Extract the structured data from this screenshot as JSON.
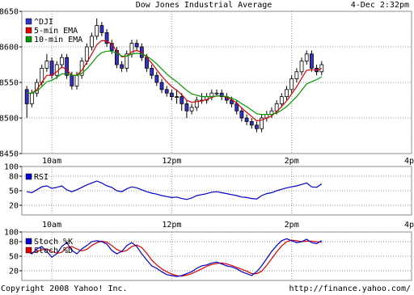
{
  "header": {
    "title": "Dow Jones Industrial Average",
    "datetime": "4-Dec 2:32pm"
  },
  "footer": {
    "copyright": "Copyright 2008 Yahoo! Inc.",
    "url": "http://finance.yahoo.com/"
  },
  "colors": {
    "candle_up": "#ffffff",
    "candle_down": "#3333cc",
    "ema5": "#dd0000",
    "ema10": "#009900",
    "rsi": "#0000cc",
    "stoch_k": "#0000cc",
    "stoch_d": "#dd0000",
    "grid": "#999999"
  },
  "chart_data": [
    {
      "type": "candlestick",
      "title": "Dow Jones Industrial Average",
      "x_ticks": [
        "10am",
        "12pm",
        "2pm",
        "4pm"
      ],
      "y_ticks": [
        8450,
        8500,
        8550,
        8600,
        8650
      ],
      "ylim": [
        8450,
        8650
      ],
      "x_range": [
        "9:30",
        "4:00"
      ],
      "grid": true,
      "legend": {
        "position": "top-left",
        "entries": [
          "^DJI",
          "5-min EMA",
          "10-min EMA"
        ]
      },
      "series": [
        {
          "name": "^DJI",
          "times": [
            "09:35",
            "09:40",
            "09:45",
            "09:50",
            "09:55",
            "10:00",
            "10:05",
            "10:10",
            "10:15",
            "10:20",
            "10:25",
            "10:30",
            "10:35",
            "10:40",
            "10:45",
            "10:50",
            "10:55",
            "11:00",
            "11:05",
            "11:10",
            "11:15",
            "11:20",
            "11:25",
            "11:30",
            "11:35",
            "11:40",
            "11:45",
            "11:50",
            "11:55",
            "12:00",
            "12:05",
            "12:10",
            "12:15",
            "12:20",
            "12:25",
            "12:30",
            "12:35",
            "12:40",
            "12:45",
            "12:50",
            "12:55",
            "13:00",
            "13:05",
            "13:10",
            "13:15",
            "13:20",
            "13:25",
            "13:30",
            "13:35",
            "13:40",
            "13:45",
            "13:50",
            "13:55",
            "14:00",
            "14:05",
            "14:10",
            "14:15",
            "14:20",
            "14:25",
            "14:30"
          ],
          "open": [
            8540,
            8520,
            8535,
            8550,
            8570,
            8580,
            8560,
            8575,
            8585,
            8560,
            8545,
            8560,
            8580,
            8600,
            8615,
            8630,
            8620,
            8605,
            8595,
            8575,
            8570,
            8590,
            8605,
            8600,
            8585,
            8570,
            8560,
            8550,
            8540,
            8535,
            8530,
            8530,
            8520,
            8510,
            8515,
            8525,
            8525,
            8530,
            8535,
            8535,
            8530,
            8525,
            8520,
            8510,
            8500,
            8495,
            8490,
            8485,
            8500,
            8505,
            8510,
            8520,
            8530,
            8540,
            8555,
            8565,
            8580,
            8590,
            8570,
            8565
          ],
          "close": [
            8520,
            8535,
            8550,
            8570,
            8580,
            8560,
            8575,
            8585,
            8560,
            8545,
            8560,
            8580,
            8600,
            8615,
            8630,
            8620,
            8605,
            8595,
            8575,
            8570,
            8590,
            8605,
            8600,
            8585,
            8570,
            8560,
            8550,
            8540,
            8535,
            8530,
            8530,
            8520,
            8510,
            8515,
            8525,
            8525,
            8530,
            8535,
            8535,
            8530,
            8525,
            8520,
            8510,
            8500,
            8495,
            8490,
            8485,
            8500,
            8505,
            8510,
            8520,
            8530,
            8540,
            8555,
            8565,
            8580,
            8590,
            8570,
            8565,
            8575
          ],
          "high": [
            8545,
            8540,
            8555,
            8575,
            8590,
            8585,
            8580,
            8590,
            8590,
            8565,
            8565,
            8585,
            8605,
            8620,
            8640,
            8635,
            8625,
            8610,
            8600,
            8580,
            8595,
            8610,
            8610,
            8605,
            8590,
            8575,
            8565,
            8555,
            8545,
            8540,
            8540,
            8535,
            8525,
            8520,
            8530,
            8535,
            8535,
            8540,
            8540,
            8540,
            8535,
            8530,
            8525,
            8515,
            8505,
            8500,
            8495,
            8505,
            8510,
            8515,
            8525,
            8535,
            8545,
            8560,
            8570,
            8585,
            8595,
            8595,
            8575,
            8580
          ],
          "low": [
            8500,
            8515,
            8530,
            8545,
            8565,
            8555,
            8555,
            8570,
            8555,
            8540,
            8540,
            8555,
            8575,
            8595,
            8610,
            8615,
            8600,
            8590,
            8570,
            8565,
            8565,
            8585,
            8595,
            8580,
            8565,
            8555,
            8545,
            8535,
            8530,
            8525,
            8520,
            8510,
            8500,
            8505,
            8510,
            8520,
            8520,
            8525,
            8530,
            8525,
            8520,
            8515,
            8505,
            8495,
            8490,
            8485,
            8480,
            8480,
            8495,
            8500,
            8505,
            8515,
            8525,
            8535,
            8550,
            8560,
            8575,
            8565,
            8560,
            8560
          ]
        },
        {
          "name": "5-min EMA",
          "values": [
            8535,
            8535,
            8540,
            8550,
            8560,
            8560,
            8565,
            8572,
            8568,
            8560,
            8560,
            8567,
            8578,
            8590,
            8603,
            8609,
            8608,
            8604,
            8594,
            8586,
            8587,
            8593,
            8595,
            8592,
            8585,
            8577,
            8568,
            8559,
            8551,
            8544,
            8539,
            8533,
            8525,
            8522,
            8523,
            8524,
            8526,
            8529,
            8531,
            8531,
            8529,
            8526,
            8521,
            8514,
            8508,
            8502,
            8496,
            8497,
            8500,
            8503,
            8509,
            8516,
            8524,
            8534,
            8544,
            8556,
            8567,
            8568,
            8567,
            8570
          ]
        },
        {
          "name": "10-min EMA",
          "values": [
            8535,
            8535,
            8538,
            8544,
            8551,
            8553,
            8557,
            8562,
            8562,
            8560,
            8560,
            8563,
            8569,
            8577,
            8586,
            8592,
            8594,
            8594,
            8591,
            8587,
            8587,
            8590,
            8591,
            8590,
            8587,
            8582,
            8576,
            8569,
            8562,
            8556,
            8551,
            8545,
            8539,
            8534,
            8532,
            8530,
            8530,
            8530,
            8531,
            8531,
            8530,
            8528,
            8525,
            8520,
            8516,
            8511,
            8506,
            8505,
            8505,
            8505,
            8507,
            8511,
            8516,
            8523,
            8530,
            8539,
            8548,
            8551,
            8554,
            8558
          ]
        }
      ]
    },
    {
      "type": "line",
      "x_ticks": [
        "10am",
        "12pm",
        "2pm",
        "4pm"
      ],
      "y_ticks": [
        20,
        50,
        80,
        100
      ],
      "ylim": [
        0,
        100
      ],
      "reference_lines": [
        20,
        80
      ],
      "legend": {
        "position": "top-left",
        "entries": [
          "RSI"
        ]
      },
      "series": [
        {
          "name": "RSI",
          "values": [
            48,
            46,
            52,
            58,
            60,
            55,
            57,
            60,
            52,
            48,
            52,
            57,
            62,
            66,
            70,
            66,
            60,
            57,
            50,
            48,
            54,
            58,
            56,
            52,
            48,
            45,
            43,
            40,
            38,
            36,
            37,
            34,
            32,
            35,
            40,
            42,
            44,
            47,
            48,
            46,
            44,
            42,
            40,
            37,
            36,
            34,
            33,
            40,
            44,
            46,
            50,
            53,
            56,
            58,
            60,
            63,
            66,
            58,
            57,
            64
          ]
        }
      ]
    },
    {
      "type": "line",
      "x_ticks": [
        "10am",
        "12pm",
        "2pm",
        "4pm"
      ],
      "y_ticks": [
        20,
        50,
        80,
        100
      ],
      "ylim": [
        0,
        100
      ],
      "reference_lines": [
        20,
        80
      ],
      "legend": {
        "position": "top-left",
        "entries": [
          "Stoch %K",
          "Stoch %D"
        ]
      },
      "series": [
        {
          "name": "Stoch %K",
          "values": [
            60,
            55,
            65,
            70,
            60,
            48,
            55,
            70,
            78,
            62,
            55,
            65,
            72,
            80,
            82,
            80,
            75,
            62,
            55,
            60,
            72,
            78,
            70,
            55,
            42,
            30,
            25,
            18,
            12,
            10,
            8,
            10,
            14,
            18,
            25,
            30,
            32,
            36,
            38,
            34,
            30,
            28,
            24,
            18,
            14,
            10,
            18,
            30,
            45,
            60,
            72,
            82,
            86,
            82,
            78,
            80,
            85,
            78,
            76,
            82
          ]
        },
        {
          "name": "Stoch %D",
          "values": [
            58,
            57,
            60,
            63,
            65,
            60,
            56,
            58,
            68,
            70,
            65,
            61,
            64,
            72,
            78,
            81,
            79,
            72,
            64,
            59,
            62,
            70,
            73,
            68,
            56,
            42,
            32,
            24,
            18,
            13,
            10,
            9,
            11,
            14,
            19,
            24,
            29,
            33,
            35,
            36,
            34,
            31,
            27,
            23,
            19,
            14,
            14,
            19,
            31,
            45,
            59,
            71,
            80,
            83,
            82,
            80,
            81,
            81,
            80,
            79
          ]
        }
      ]
    }
  ]
}
